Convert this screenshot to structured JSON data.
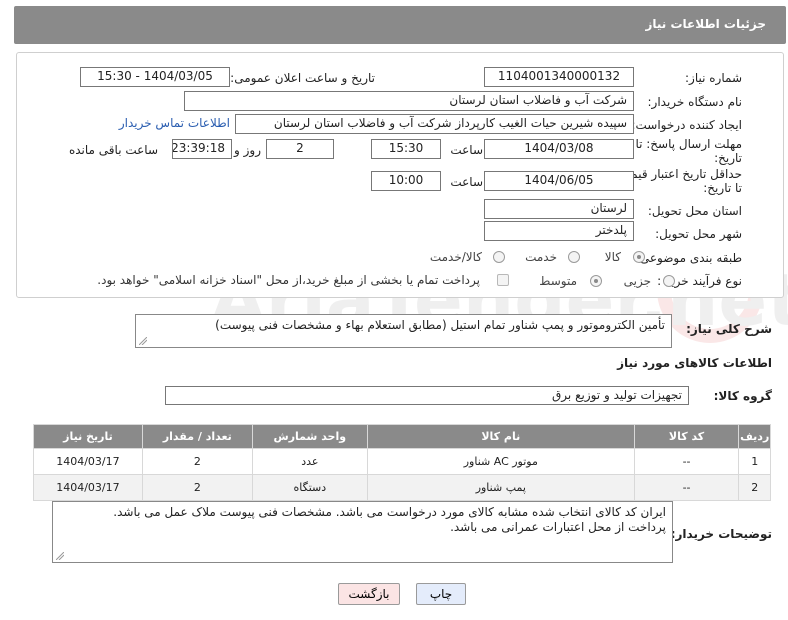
{
  "header": {
    "title": "جزئیات اطلاعات نیاز"
  },
  "form": {
    "need_number_label": "شماره نیاز:",
    "need_number": "1104001340000132",
    "announce_label": "تاریخ و ساعت اعلان عمومی:",
    "announce_value": "1404/03/05 - 15:30",
    "buyer_org_label": "نام دستگاه خریدار:",
    "buyer_org": "شرکت آب و فاضلاب استان لرستان",
    "creator_label": "ایجاد کننده درخواست:",
    "creator": "سپیده شیرین حیات الغیب کارپرداز شرکت آب و فاضلاب استان لرستان",
    "contact_link": "اطلاعات تماس خریدار",
    "deadline_label_1": "مهلت ارسال پاسخ: تا",
    "deadline_label_2": "تاریخ:",
    "deadline_date": "1404/03/08",
    "time_label": "ساعت",
    "deadline_time": "15:30",
    "days_value": "2",
    "days_label": "روز و",
    "remaining_time": "23:39:18",
    "remaining_label": "ساعت باقی مانده",
    "price_validity_label_1": "حداقل تاریخ اعتبار قیمت:",
    "price_validity_label_2": "تا تاریخ:",
    "price_validity_date": "1404/06/05",
    "price_validity_time": "10:00",
    "delivery_province_label": "استان محل تحویل:",
    "delivery_province": "لرستان",
    "delivery_city_label": "شهر محل تحویل:",
    "delivery_city": "پلدختر",
    "category_label": "طبقه بندی موضوعی:",
    "category_options": [
      "کالا",
      "خدمت",
      "کالا/خدمت"
    ],
    "purchase_type_label": "نوع فرآیند خرید :",
    "purchase_type_options": [
      "جزیی",
      "متوسط"
    ],
    "payment_note": "پرداخت تمام یا بخشی از مبلغ خرید،از محل \"اسناد خزانه اسلامی\" خواهد بود."
  },
  "description": {
    "label": "شرح کلی نیاز:",
    "text": "تأمین الکتروموتور و پمپ شناور تمام استیل (مطابق استعلام بهاء و مشخصات فنی پیوست)"
  },
  "goods": {
    "section_title": "اطلاعات کالاهای مورد نیاز",
    "group_label": "گروه کالا:",
    "group_value": "تجهیزات تولید و توزیع برق",
    "columns": [
      "ردیف",
      "کد کالا",
      "نام کالا",
      "واحد شمارش",
      "تعداد / مقدار",
      "تاریخ نیاز"
    ],
    "rows": [
      {
        "row": "1",
        "code": "--",
        "name": "موتور AC شناور",
        "unit": "عدد",
        "qty": "2",
        "date": "1404/03/17"
      },
      {
        "row": "2",
        "code": "--",
        "name": "پمپ شناور",
        "unit": "دستگاه",
        "qty": "2",
        "date": "1404/03/17"
      }
    ]
  },
  "buyer_notes": {
    "label": "توضیحات خریدار:",
    "line1": "ایران کد کالای انتخاب شده مشابه کالای مورد درخواست می باشد. مشخصات فنی پیوست ملاک عمل می باشد.",
    "line2": "پرداخت از محل اعتبارات عمرانی می باشد."
  },
  "buttons": {
    "print": "چاپ",
    "back": "بازگشت"
  },
  "colors": {
    "header_bg": "#8a8a8a",
    "link": "#2a5db0",
    "back_button_bg": "#fbe4e4",
    "print_button_bg": "#e4ecfb"
  },
  "watermark": {
    "brand": "AriaTender.net"
  }
}
